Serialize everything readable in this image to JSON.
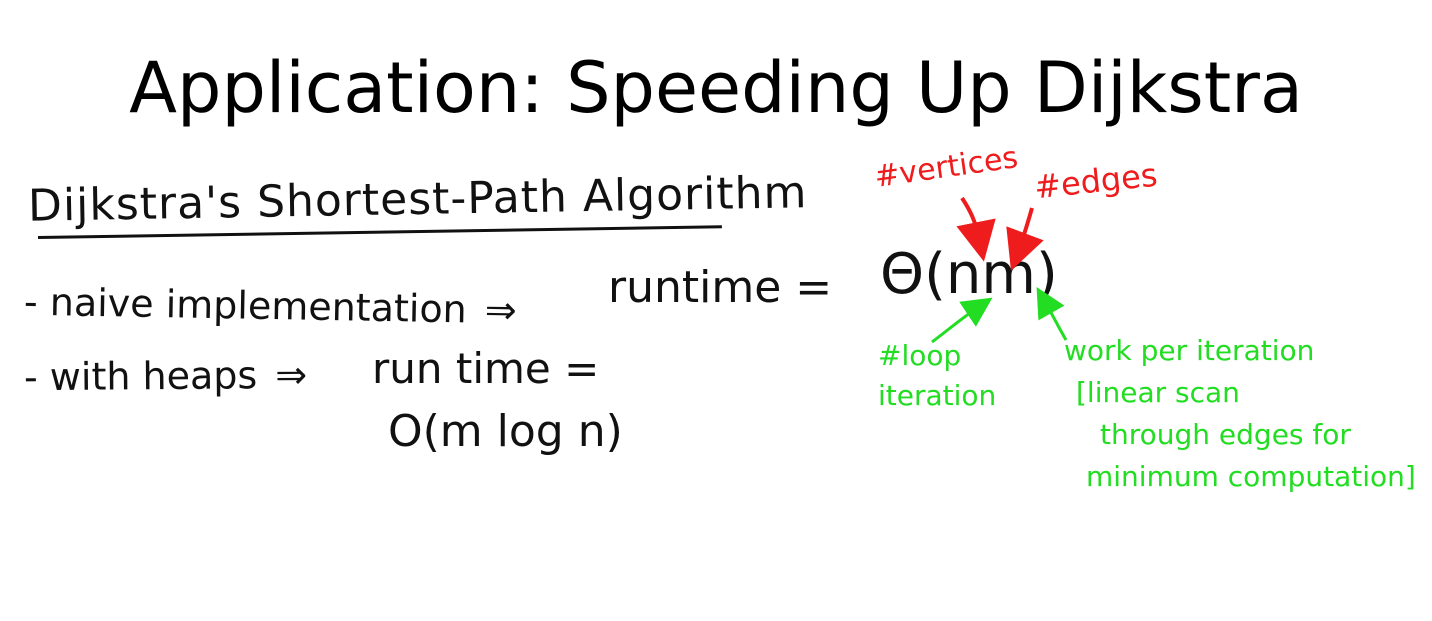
{
  "slide": {
    "title": "Application: Speeding Up Dijkstra",
    "heading": "Dijkstra's Shortest-Path Algorithm",
    "bullets": [
      {
        "dash": "-",
        "text": "naive implementation",
        "arrow": "⇒"
      },
      {
        "dash": "-",
        "text": "with heaps",
        "arrow": "⇒"
      }
    ],
    "runtime_label": "runtime =",
    "heap_runtime_label": "run time =",
    "heap_runtime_value": "O(m log n)",
    "naive_runtime_value": "Θ(nm)",
    "annotations": {
      "vertices": "#vertices",
      "edges": "#edges",
      "loop": [
        "#loop",
        "iteration"
      ],
      "work": [
        "work per iteration",
        "[linear scan",
        "through edges for",
        "minimum computation]"
      ]
    },
    "colors": {
      "ink": "#111111",
      "red_ink": "#ee1c1c",
      "green_ink": "#22dd22"
    }
  }
}
